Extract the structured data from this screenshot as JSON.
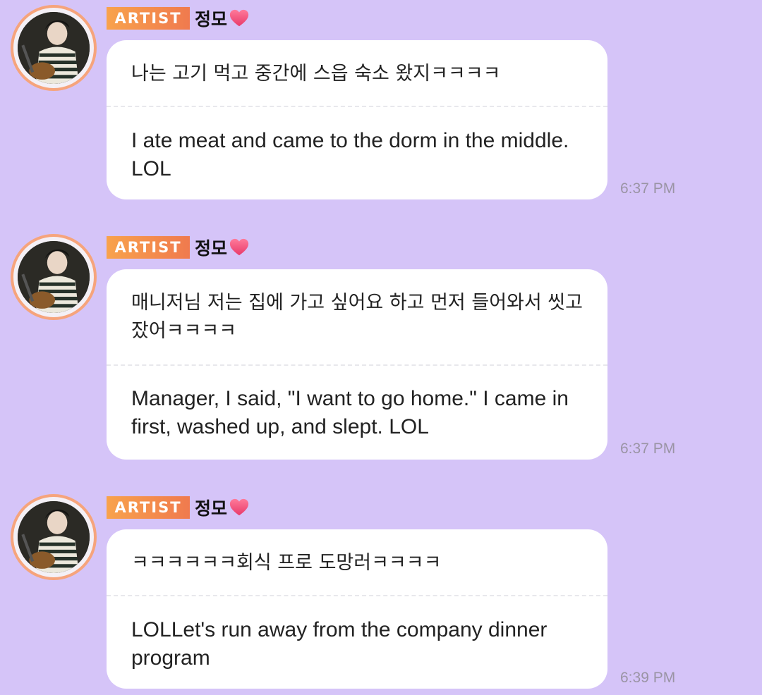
{
  "messages": [
    {
      "badge": "ARTIST",
      "sender": "정모",
      "sender_icon": "heart-icon",
      "text_ko": "나는 고기 먹고 중간에 스읍 숙소 왔지ㅋㅋㅋㅋ",
      "text_en": "I ate meat and came to the dorm in the middle. LOL",
      "time": "6:37 PM"
    },
    {
      "badge": "ARTIST",
      "sender": "정모",
      "sender_icon": "heart-icon",
      "text_ko": "매니저님 저는 집에 가고 싶어요 하고 먼저 들어와서 씻고 잤어ㅋㅋㅋㅋ",
      "text_en": "Manager, I said, \"I want to go home.\" I came in first, washed up, and slept. LOL",
      "time": "6:37 PM"
    },
    {
      "badge": "ARTIST",
      "sender": "정모",
      "sender_icon": "heart-icon",
      "text_ko": "ㅋㅋㅋㅋㅋㅋ회식 프로 도망러ㅋㅋㅋㅋ",
      "text_en": "LOLLet's run away from the company dinner program",
      "time": "6:39 PM"
    }
  ],
  "colors": {
    "background": "#d5c4f8",
    "badge_start": "#f8a24c",
    "badge_end": "#f07a4e",
    "avatar_ring": "#f6a47c",
    "heart": "#f0527a",
    "time": "#9a94a4"
  }
}
